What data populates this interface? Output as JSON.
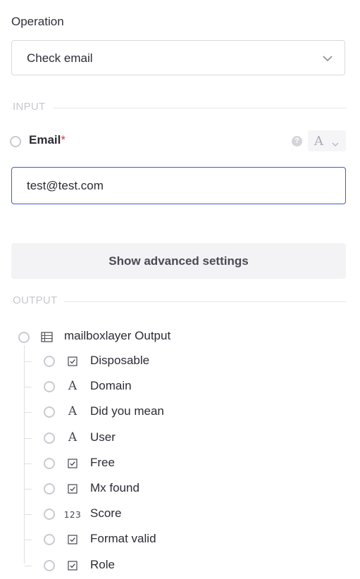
{
  "operation": {
    "label": "Operation",
    "selected": "Check email"
  },
  "input_section": {
    "title": "INPUT",
    "email": {
      "label": "Email",
      "required_mark": "*",
      "help_icon": "question-icon",
      "type_glyph": "A",
      "value": "test@test.com"
    },
    "advanced_button": "Show advanced settings"
  },
  "output_section": {
    "title": "OUTPUT",
    "root": {
      "label": "mailboxlayer Output",
      "icon": "table-icon"
    },
    "fields": [
      {
        "label": "Disposable",
        "type": "boolean",
        "glyph": ""
      },
      {
        "label": "Domain",
        "type": "text",
        "glyph": "A"
      },
      {
        "label": "Did you mean",
        "type": "text",
        "glyph": "A"
      },
      {
        "label": "User",
        "type": "text",
        "glyph": "A"
      },
      {
        "label": "Free",
        "type": "boolean",
        "glyph": ""
      },
      {
        "label": "Mx found",
        "type": "boolean",
        "glyph": ""
      },
      {
        "label": "Score",
        "type": "number",
        "glyph": "123"
      },
      {
        "label": "Format valid",
        "type": "boolean",
        "glyph": ""
      },
      {
        "label": "Role",
        "type": "boolean",
        "glyph": ""
      }
    ]
  },
  "colors": {
    "accent": "#3a5bd9",
    "required": "#e0383e",
    "muted": "#c6c7cf"
  }
}
